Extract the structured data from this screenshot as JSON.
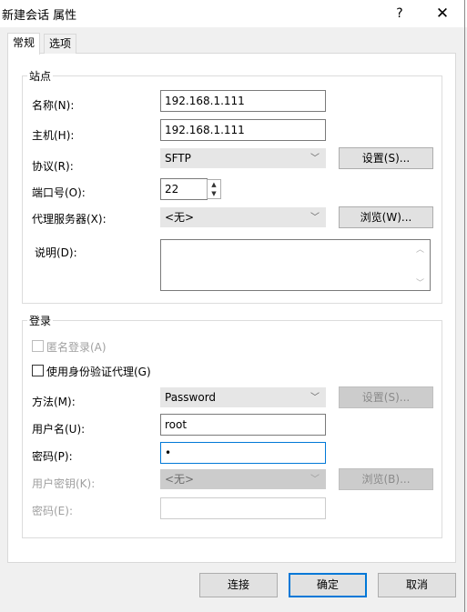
{
  "window": {
    "title": "新建会话 属性",
    "help": "?",
    "close": "✕"
  },
  "tabs": [
    {
      "label": "常规"
    },
    {
      "label": "选项"
    }
  ],
  "site": {
    "group_label": "站点",
    "name_label": "名称(N):",
    "name_value": "192.168.1.111",
    "host_label": "主机(H):",
    "host_value": "192.168.1.111",
    "protocol_label": "协议(R):",
    "protocol_value": "SFTP",
    "protocol_settings": "设置(S)...",
    "port_label": "端口号(O):",
    "port_value": "22",
    "proxy_label": "代理服务器(X):",
    "proxy_value": "<无>",
    "proxy_browse": "浏览(W)...",
    "desc_label": "说明(D):",
    "desc_value": ""
  },
  "login": {
    "group_label": "登录",
    "anonymous_label": "匿名登录(A)",
    "agent_label": "使用身份验证代理(G)",
    "method_label": "方法(M):",
    "method_value": "Password",
    "method_settings": "设置(S)...",
    "user_label": "用户名(U):",
    "user_value": "root",
    "password_label": "密码(P):",
    "password_value": "•",
    "userkey_label": "用户密钥(K):",
    "userkey_value": "<无>",
    "userkey_browse": "浏览(B)...",
    "passphrase_label": "密码(E):",
    "passphrase_value": ""
  },
  "footer": {
    "connect": "连接",
    "ok": "确定",
    "cancel": "取消"
  }
}
